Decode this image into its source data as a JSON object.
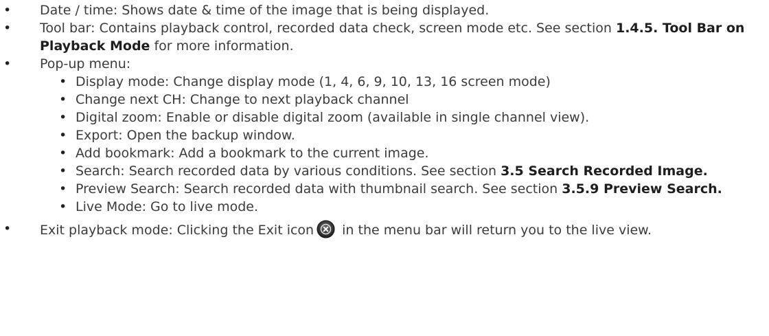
{
  "items": {
    "date_time": "Date / time: Shows date & time of the image that is being displayed.",
    "toolbar_pre": "Tool bar: Contains playback control, recorded data check, screen mode etc. See section ",
    "toolbar_ref": "1.4.5. Tool Bar on Playback Mode",
    "toolbar_post": " for more information.",
    "popup": "Pop-up menu:",
    "sub": {
      "display_mode": "Display mode: Change display mode (1, 4, 6, 9, 10, 13, 16 screen mode)",
      "change_next_ch": "Change next CH: Change to next playback channel",
      "digital_zoom": "Digital zoom: Enable or disable digital zoom (available in single channel view).",
      "export": "Export: Open the backup window.",
      "add_bookmark": "Add bookmark: Add a bookmark to the current image.",
      "search_pre": "Search: Search recorded data by various conditions. See section ",
      "search_ref": "3.5 Search Recorded Image.",
      "preview_pre": "Preview Search: Search recorded data with thumbnail search. See section ",
      "preview_ref": "3.5.9 Preview Search.",
      "live_mode": "Live Mode: Go to live mode."
    },
    "exit_pre": "Exit playback mode: Clicking the Exit icon",
    "exit_post": " in the menu bar will return you to the live view.",
    "exit_icon": "close-circle-icon"
  }
}
